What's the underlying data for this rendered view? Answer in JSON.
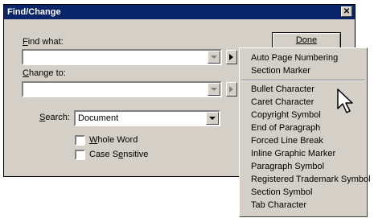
{
  "window": {
    "title": "Find/Change",
    "close_glyph": "✕"
  },
  "find": {
    "label": "Find what:",
    "value": ""
  },
  "change": {
    "label": "Change to:",
    "value": ""
  },
  "search": {
    "label": "Search:",
    "value": "Document"
  },
  "options": {
    "whole_word": "Whole Word",
    "case_sensitive": "Case Sensitive",
    "whole_word_checked": false,
    "case_sensitive_checked": false
  },
  "buttons": {
    "done": "Done"
  },
  "menu": {
    "group1": [
      "Auto Page Numbering",
      "Section Marker"
    ],
    "group2": [
      "Bullet Character",
      "Caret Character",
      "Copyright Symbol",
      "End of Paragraph",
      "Forced Line Break",
      "Inline Graphic Marker",
      "Paragraph Symbol",
      "Registered Trademark Symbol",
      "Section Symbol",
      "Tab Character"
    ]
  },
  "icons": {
    "cursor": "arrow-cursor-icon",
    "dropdown": "chevron-down-icon",
    "menu_arrow": "triangle-right-icon"
  }
}
